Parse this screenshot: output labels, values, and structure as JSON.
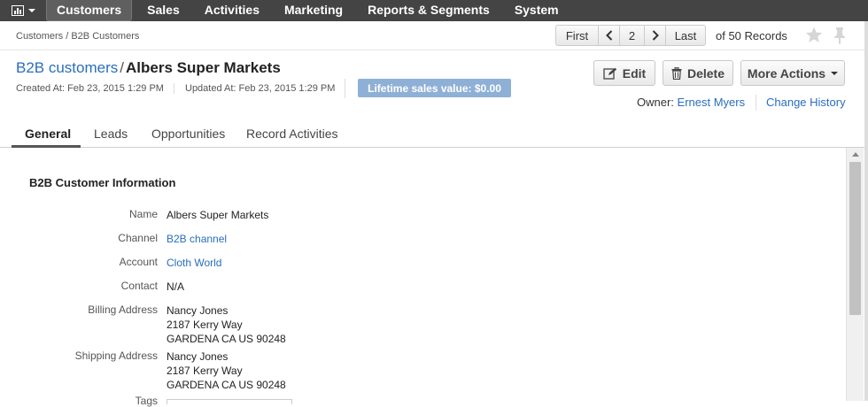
{
  "nav": {
    "items": [
      {
        "label": "Customers",
        "active": true
      },
      {
        "label": "Sales"
      },
      {
        "label": "Activities"
      },
      {
        "label": "Marketing"
      },
      {
        "label": "Reports & Segments"
      },
      {
        "label": "System"
      }
    ]
  },
  "breadcrumb": "Customers / B2B Customers",
  "pager": {
    "first": "First",
    "current": "2",
    "last": "Last",
    "records": "of 50 Records"
  },
  "header": {
    "entity_link": "B2B customers",
    "separator": "/",
    "record_name": "Albers Super Markets",
    "created": "Created At: Feb 23, 2015 1:29 PM",
    "updated": "Updated At: Feb 23, 2015 1:29 PM",
    "lifetime": "Lifetime sales value: $0.00",
    "owner_label": "Owner:",
    "owner_name": "Ernest Myers",
    "change_history": "Change History"
  },
  "actions": {
    "edit": "Edit",
    "delete": "Delete",
    "more": "More Actions"
  },
  "tabs": [
    "General",
    "Leads",
    "Opportunities",
    "Record Activities"
  ],
  "section": {
    "title": "B2B Customer Information",
    "fields": {
      "name_label": "Name",
      "name_value": "Albers Super Markets",
      "channel_label": "Channel",
      "channel_value": "B2B channel",
      "account_label": "Account",
      "account_value": "Cloth World",
      "contact_label": "Contact",
      "contact_value": "N/A",
      "billing_label": "Billing Address",
      "billing_lines": [
        "Nancy Jones",
        "2187 Kerry Way",
        "GARDENA CA US 90248"
      ],
      "shipping_label": "Shipping Address",
      "shipping_lines": [
        "Nancy Jones",
        "2187 Kerry Way",
        "GARDENA CA US 90248"
      ],
      "tags_label": "Tags"
    }
  },
  "icons": {
    "menu": "bar-chart-icon",
    "prev": "chevron-left-icon",
    "next": "chevron-right-icon",
    "favorite": "star-icon",
    "pin": "pin-icon",
    "edit": "edit-icon",
    "delete": "trash-icon"
  }
}
